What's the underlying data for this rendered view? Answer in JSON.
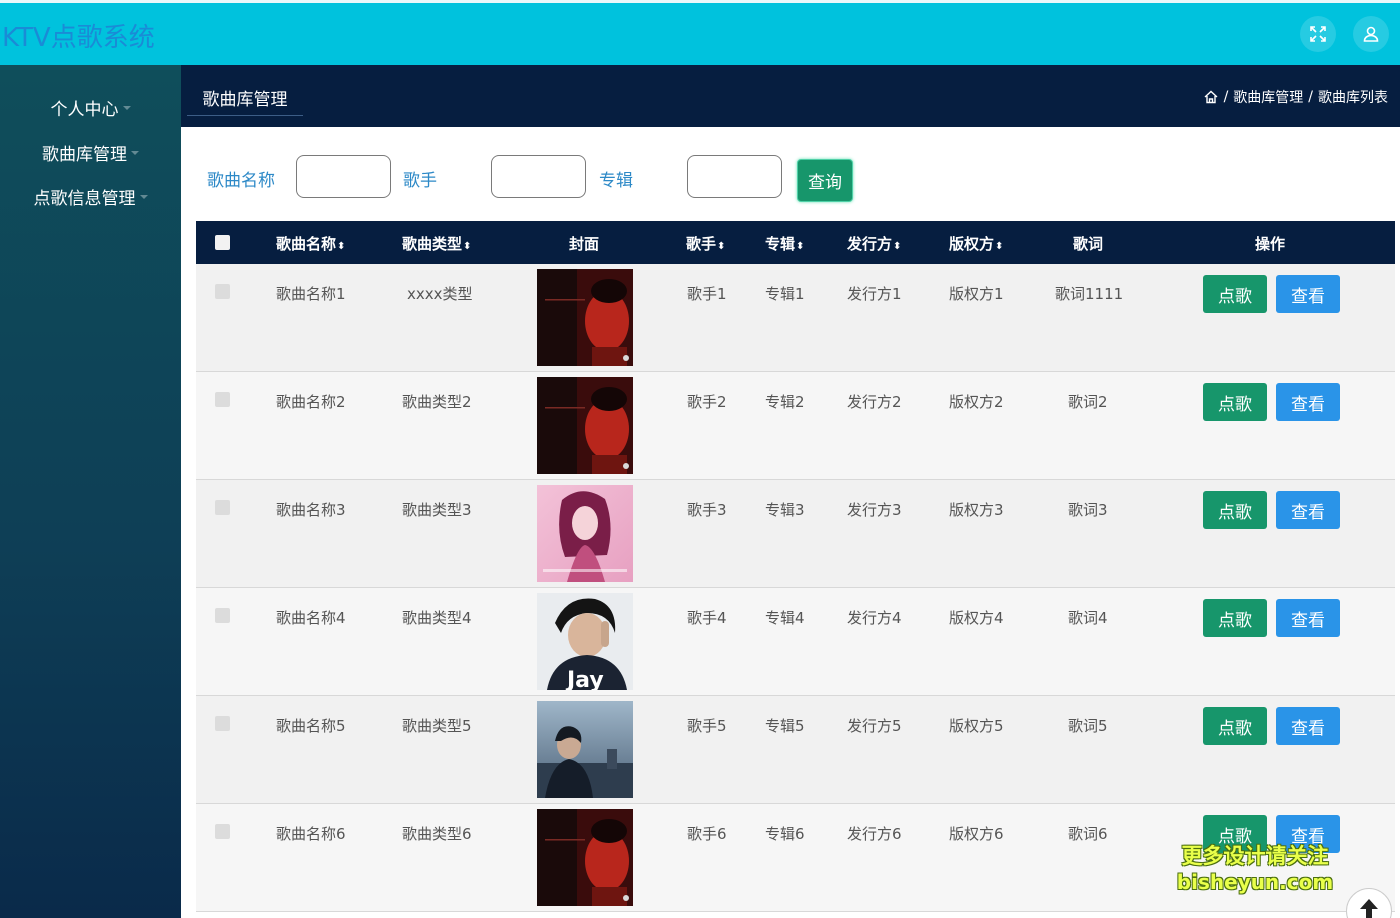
{
  "app": {
    "title": "KTV点歌系统"
  },
  "sidebar": {
    "items": [
      {
        "label": "个人中心"
      },
      {
        "label": "歌曲库管理"
      },
      {
        "label": "点歌信息管理"
      }
    ]
  },
  "header": {
    "tab": "歌曲库管理",
    "breadcrumb": [
      "歌曲库管理",
      "歌曲库列表"
    ],
    "separator": "/"
  },
  "search": {
    "fields": [
      {
        "label": "歌曲名称",
        "value": "",
        "placeholder": ""
      },
      {
        "label": "歌手",
        "value": "",
        "placeholder": ""
      },
      {
        "label": "专辑",
        "value": "",
        "placeholder": ""
      }
    ],
    "button": "查询"
  },
  "table": {
    "columns": [
      "歌曲名称",
      "歌曲类型",
      "封面",
      "歌手",
      "专辑",
      "发行方",
      "版权方",
      "歌词",
      "操作"
    ],
    "sort_glyph": "⬍",
    "play_label": "点歌",
    "view_label": "查看",
    "rows": [
      {
        "name": "歌曲名称1",
        "type": "xxxx类型",
        "cover": "cover-red-portrait",
        "singer": "歌手1",
        "album": "专辑1",
        "publisher": "发行方1",
        "copyright": "版权方1",
        "lyrics": "歌词1111"
      },
      {
        "name": "歌曲名称2",
        "type": "歌曲类型2",
        "cover": "cover-red-portrait",
        "singer": "歌手2",
        "album": "专辑2",
        "publisher": "发行方2",
        "copyright": "版权方2",
        "lyrics": "歌词2"
      },
      {
        "name": "歌曲名称3",
        "type": "歌曲类型3",
        "cover": "cover-pink-woman",
        "singer": "歌手3",
        "album": "专辑3",
        "publisher": "发行方3",
        "copyright": "版权方3",
        "lyrics": "歌词3"
      },
      {
        "name": "歌曲名称4",
        "type": "歌曲类型4",
        "cover": "cover-jay",
        "singer": "歌手4",
        "album": "专辑4",
        "publisher": "发行方4",
        "copyright": "版权方4",
        "lyrics": "歌词4"
      },
      {
        "name": "歌曲名称5",
        "type": "歌曲类型5",
        "cover": "cover-blue-city",
        "singer": "歌手5",
        "album": "专辑5",
        "publisher": "发行方5",
        "copyright": "版权方5",
        "lyrics": "歌词5"
      },
      {
        "name": "歌曲名称6",
        "type": "歌曲类型6",
        "cover": "cover-red-portrait",
        "singer": "歌手6",
        "album": "专辑6",
        "publisher": "发行方6",
        "copyright": "版权方6",
        "lyrics": "歌词6"
      }
    ]
  },
  "cover_text": {
    "jay": "Jay"
  },
  "watermark": {
    "line1": "更多设计请关注",
    "line2": "bisheyun.com"
  },
  "colors": {
    "topbar": "#00c2dd",
    "header": "#061e40",
    "primary_green": "#17966b",
    "primary_blue": "#2a94e8",
    "label_blue": "#2d89c7"
  }
}
